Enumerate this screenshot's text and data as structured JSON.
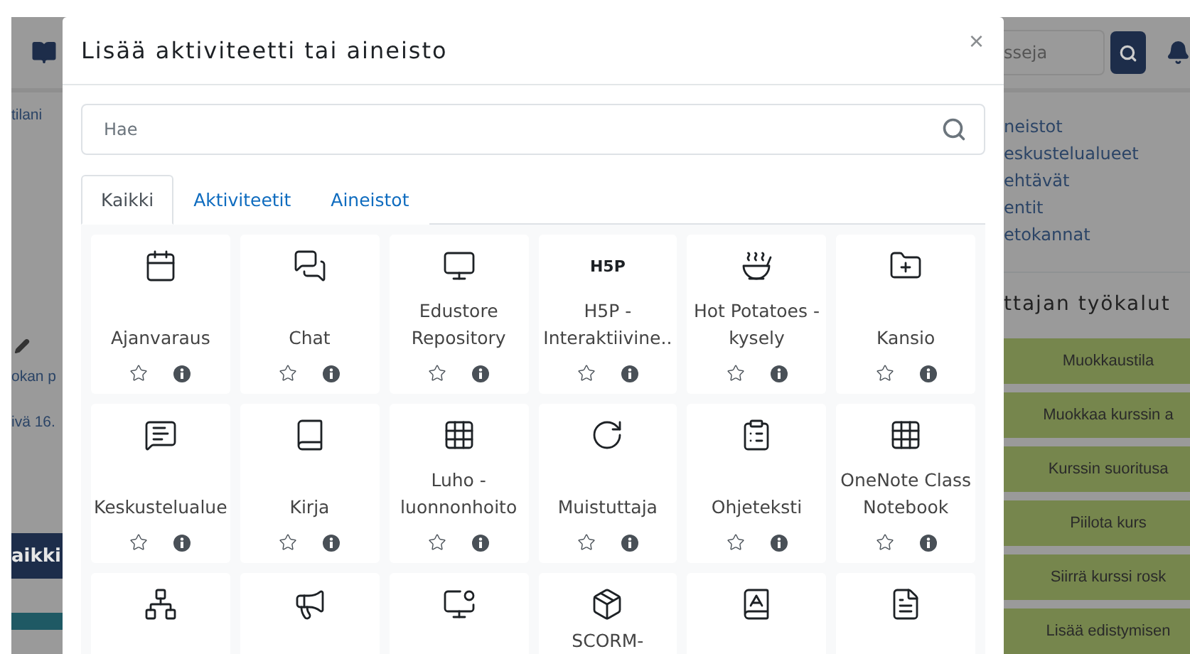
{
  "background_page": {
    "left_texts": [
      "tilani",
      "okan p",
      "ivä 16."
    ],
    "left_bar": "aikki",
    "search_placeholder": "sseja",
    "links": [
      "neistot",
      "eskustelualueet",
      "ehtävät",
      "entit",
      "etokannat"
    ],
    "tools_heading": "ttajan työkalut",
    "tool_buttons": [
      "Muokkaustila",
      "Muokkaa kurssin a",
      "Kurssin suoritusa",
      "Piilota kurs",
      "Siirrä kurssi rosk",
      "Lisää edistymisen"
    ]
  },
  "dialog": {
    "title": "Lisää aktiviteetti tai aineisto",
    "close": "×",
    "search": {
      "placeholder": "Hae"
    },
    "tabs": [
      {
        "label": "Kaikki",
        "selected": true
      },
      {
        "label": "Aktiviteetit",
        "selected": false
      },
      {
        "label": "Aineistot",
        "selected": false
      }
    ],
    "items": [
      {
        "kind": "calendar",
        "name": "Ajanvaraus",
        "starred": false
      },
      {
        "kind": "chat",
        "name": "Chat",
        "starred": false
      },
      {
        "kind": "monitor",
        "name": "Edustore Repository",
        "starred": false
      },
      {
        "kind": "text",
        "icon_text": "H5P",
        "name": "H5P - Interaktiivine..",
        "starred": false
      },
      {
        "kind": "potato",
        "name": "Hot Potatoes - kysely",
        "starred": false
      },
      {
        "kind": "folder",
        "name": "Kansio",
        "starred": false
      },
      {
        "kind": "forum",
        "name": "Keskustelualue",
        "starred": false
      },
      {
        "kind": "book",
        "name": "Kirja",
        "starred": false
      },
      {
        "kind": "grid",
        "name": "Luho - luonnonhoito",
        "starred": false
      },
      {
        "kind": "reminder",
        "name": "Muistuttaja",
        "starred": false
      },
      {
        "kind": "note",
        "name": "Ohjeteksti",
        "starred": false
      },
      {
        "kind": "grid",
        "name": "OneNote Class Notebook",
        "starred": false
      },
      {
        "kind": "tree"
      },
      {
        "kind": "megaphone"
      },
      {
        "kind": "chart"
      },
      {
        "kind": "package",
        "name": "SCORM-"
      },
      {
        "kind": "glossary"
      },
      {
        "kind": "page"
      }
    ]
  }
}
